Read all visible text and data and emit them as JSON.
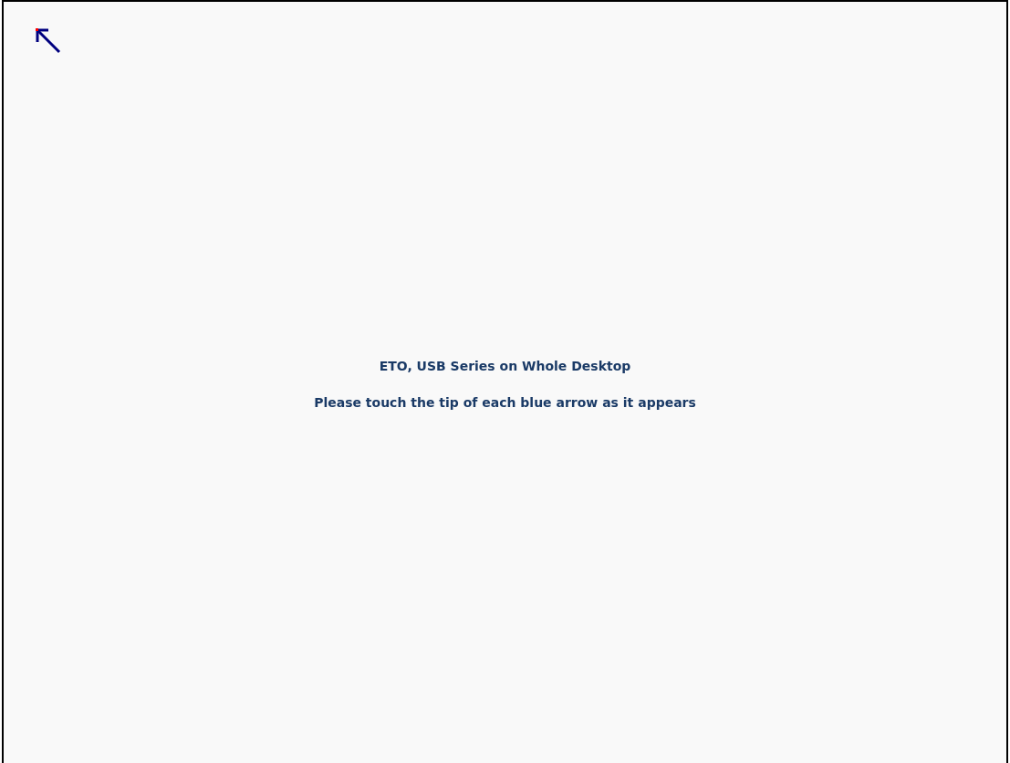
{
  "title": "ETO, USB Series on Whole Desktop",
  "instruction": "Please touch the tip of each blue arrow as it appears"
}
